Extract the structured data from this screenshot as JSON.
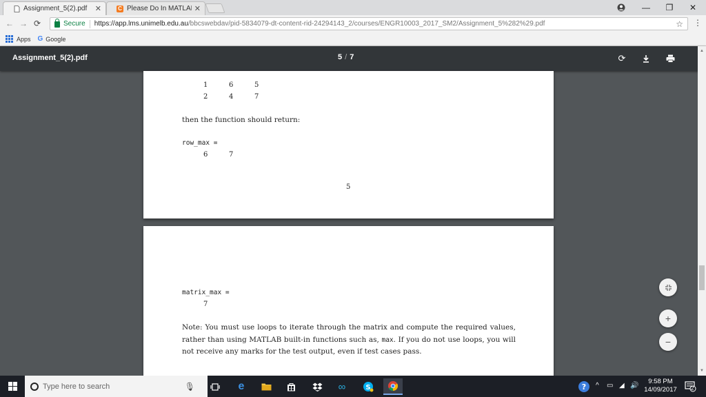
{
  "browser": {
    "tabs": [
      {
        "label": "Assignment_5(2).pdf",
        "active": true
      },
      {
        "label": "Please Do In MATLAB | C",
        "active": false
      }
    ],
    "omnibox": {
      "secure_label": "Secure",
      "url_host": "https://app.lms.unimelb.edu.au",
      "url_path": "/bbcswebdav/pid-5834079-dt-content-rid-24294143_2/courses/ENGR10003_2017_SM2/Assignment_5%282%29.pdf"
    },
    "bookmarks": [
      {
        "label": "Apps",
        "icon": "apps-grid-icon"
      },
      {
        "label": "Google",
        "icon": "google-icon"
      }
    ]
  },
  "pdf_viewer": {
    "title": "Assignment_5(2).pdf",
    "current_page": "5",
    "separator": "/",
    "total_pages": "7"
  },
  "page1": {
    "matrix_row1": [
      "1",
      "6",
      "5"
    ],
    "matrix_row2": [
      "2",
      "4",
      "7"
    ],
    "sentence": "then the function should return:",
    "output_name": "row_max =",
    "output_values": [
      "6",
      "7"
    ],
    "page_number": "5"
  },
  "page2": {
    "output_name": "matrix_max =",
    "output_value": "7",
    "note_part1": "Note: You must use loops to iterate through the matrix and compute the required values, rather than using MATLAB built-in functions such as, ",
    "note_code": "max",
    "note_part2": ". If you do not use loops, you will not receive any marks for the test output, even if test cases pass."
  },
  "taskbar": {
    "search_placeholder": "Type here to search",
    "time": "9:58 PM",
    "date": "14/09/2017",
    "notification_count": "2"
  }
}
